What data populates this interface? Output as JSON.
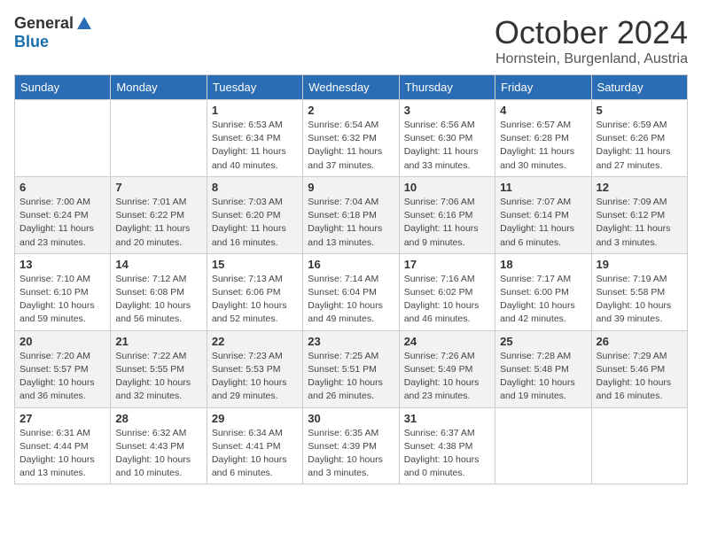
{
  "header": {
    "logo_general": "General",
    "logo_blue": "Blue",
    "month": "October 2024",
    "location": "Hornstein, Burgenland, Austria"
  },
  "weekdays": [
    "Sunday",
    "Monday",
    "Tuesday",
    "Wednesday",
    "Thursday",
    "Friday",
    "Saturday"
  ],
  "weeks": [
    [
      {
        "day": "",
        "info": ""
      },
      {
        "day": "",
        "info": ""
      },
      {
        "day": "1",
        "info": "Sunrise: 6:53 AM\nSunset: 6:34 PM\nDaylight: 11 hours and 40 minutes."
      },
      {
        "day": "2",
        "info": "Sunrise: 6:54 AM\nSunset: 6:32 PM\nDaylight: 11 hours and 37 minutes."
      },
      {
        "day": "3",
        "info": "Sunrise: 6:56 AM\nSunset: 6:30 PM\nDaylight: 11 hours and 33 minutes."
      },
      {
        "day": "4",
        "info": "Sunrise: 6:57 AM\nSunset: 6:28 PM\nDaylight: 11 hours and 30 minutes."
      },
      {
        "day": "5",
        "info": "Sunrise: 6:59 AM\nSunset: 6:26 PM\nDaylight: 11 hours and 27 minutes."
      }
    ],
    [
      {
        "day": "6",
        "info": "Sunrise: 7:00 AM\nSunset: 6:24 PM\nDaylight: 11 hours and 23 minutes."
      },
      {
        "day": "7",
        "info": "Sunrise: 7:01 AM\nSunset: 6:22 PM\nDaylight: 11 hours and 20 minutes."
      },
      {
        "day": "8",
        "info": "Sunrise: 7:03 AM\nSunset: 6:20 PM\nDaylight: 11 hours and 16 minutes."
      },
      {
        "day": "9",
        "info": "Sunrise: 7:04 AM\nSunset: 6:18 PM\nDaylight: 11 hours and 13 minutes."
      },
      {
        "day": "10",
        "info": "Sunrise: 7:06 AM\nSunset: 6:16 PM\nDaylight: 11 hours and 9 minutes."
      },
      {
        "day": "11",
        "info": "Sunrise: 7:07 AM\nSunset: 6:14 PM\nDaylight: 11 hours and 6 minutes."
      },
      {
        "day": "12",
        "info": "Sunrise: 7:09 AM\nSunset: 6:12 PM\nDaylight: 11 hours and 3 minutes."
      }
    ],
    [
      {
        "day": "13",
        "info": "Sunrise: 7:10 AM\nSunset: 6:10 PM\nDaylight: 10 hours and 59 minutes."
      },
      {
        "day": "14",
        "info": "Sunrise: 7:12 AM\nSunset: 6:08 PM\nDaylight: 10 hours and 56 minutes."
      },
      {
        "day": "15",
        "info": "Sunrise: 7:13 AM\nSunset: 6:06 PM\nDaylight: 10 hours and 52 minutes."
      },
      {
        "day": "16",
        "info": "Sunrise: 7:14 AM\nSunset: 6:04 PM\nDaylight: 10 hours and 49 minutes."
      },
      {
        "day": "17",
        "info": "Sunrise: 7:16 AM\nSunset: 6:02 PM\nDaylight: 10 hours and 46 minutes."
      },
      {
        "day": "18",
        "info": "Sunrise: 7:17 AM\nSunset: 6:00 PM\nDaylight: 10 hours and 42 minutes."
      },
      {
        "day": "19",
        "info": "Sunrise: 7:19 AM\nSunset: 5:58 PM\nDaylight: 10 hours and 39 minutes."
      }
    ],
    [
      {
        "day": "20",
        "info": "Sunrise: 7:20 AM\nSunset: 5:57 PM\nDaylight: 10 hours and 36 minutes."
      },
      {
        "day": "21",
        "info": "Sunrise: 7:22 AM\nSunset: 5:55 PM\nDaylight: 10 hours and 32 minutes."
      },
      {
        "day": "22",
        "info": "Sunrise: 7:23 AM\nSunset: 5:53 PM\nDaylight: 10 hours and 29 minutes."
      },
      {
        "day": "23",
        "info": "Sunrise: 7:25 AM\nSunset: 5:51 PM\nDaylight: 10 hours and 26 minutes."
      },
      {
        "day": "24",
        "info": "Sunrise: 7:26 AM\nSunset: 5:49 PM\nDaylight: 10 hours and 23 minutes."
      },
      {
        "day": "25",
        "info": "Sunrise: 7:28 AM\nSunset: 5:48 PM\nDaylight: 10 hours and 19 minutes."
      },
      {
        "day": "26",
        "info": "Sunrise: 7:29 AM\nSunset: 5:46 PM\nDaylight: 10 hours and 16 minutes."
      }
    ],
    [
      {
        "day": "27",
        "info": "Sunrise: 6:31 AM\nSunset: 4:44 PM\nDaylight: 10 hours and 13 minutes."
      },
      {
        "day": "28",
        "info": "Sunrise: 6:32 AM\nSunset: 4:43 PM\nDaylight: 10 hours and 10 minutes."
      },
      {
        "day": "29",
        "info": "Sunrise: 6:34 AM\nSunset: 4:41 PM\nDaylight: 10 hours and 6 minutes."
      },
      {
        "day": "30",
        "info": "Sunrise: 6:35 AM\nSunset: 4:39 PM\nDaylight: 10 hours and 3 minutes."
      },
      {
        "day": "31",
        "info": "Sunrise: 6:37 AM\nSunset: 4:38 PM\nDaylight: 10 hours and 0 minutes."
      },
      {
        "day": "",
        "info": ""
      },
      {
        "day": "",
        "info": ""
      }
    ]
  ]
}
